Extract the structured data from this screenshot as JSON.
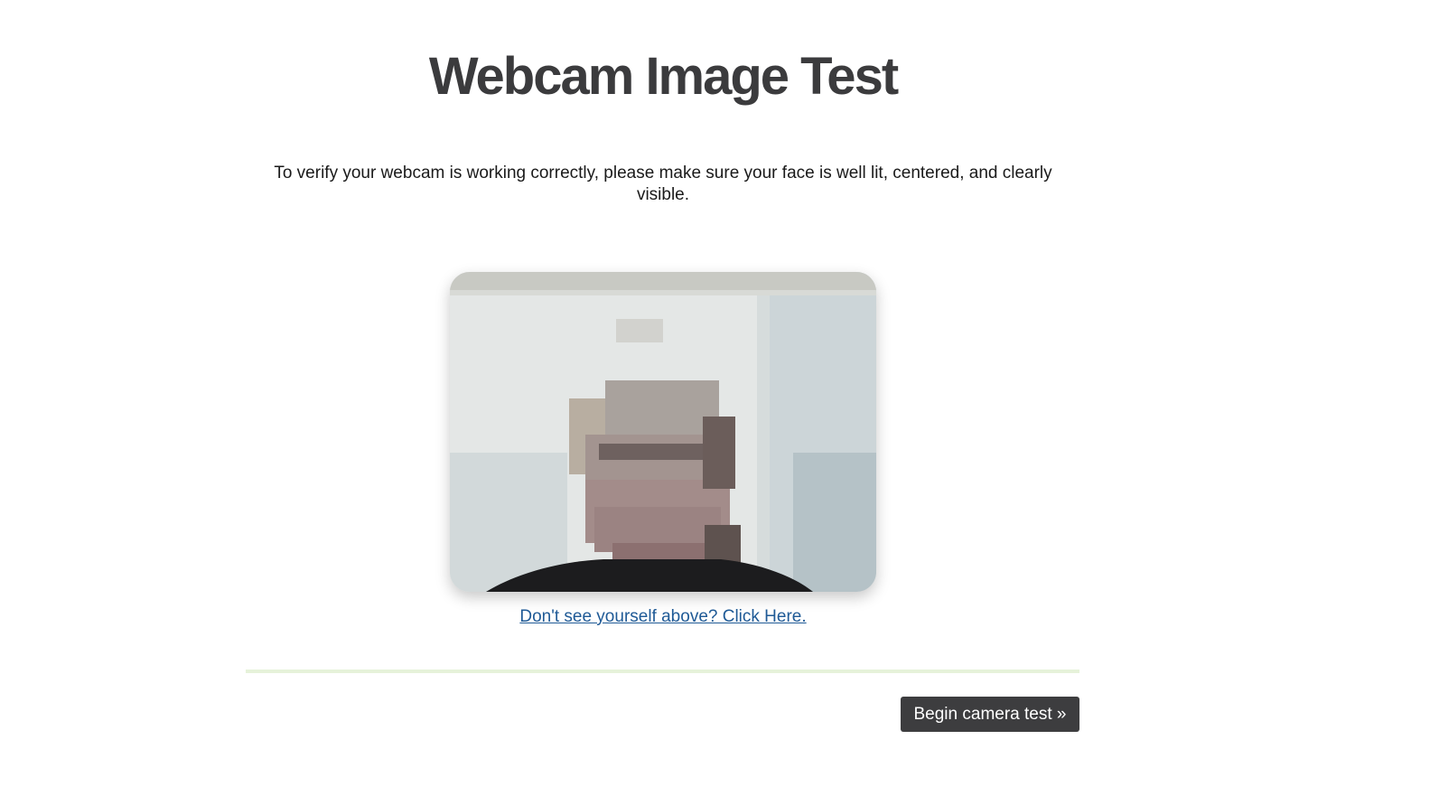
{
  "page": {
    "title": "Webcam Image Test",
    "instructions": "To verify your webcam is working correctly, please make sure your face is well lit, centered, and clearly visible.",
    "help_link": "Don't see yourself above? Click Here.",
    "begin_button": "Begin camera test »"
  },
  "colors": {
    "title": "#3b3b3d",
    "link": "#1f5a96",
    "divider": "#e6f2da",
    "button_bg": "#3d3d3f",
    "button_text": "#ffffff"
  }
}
